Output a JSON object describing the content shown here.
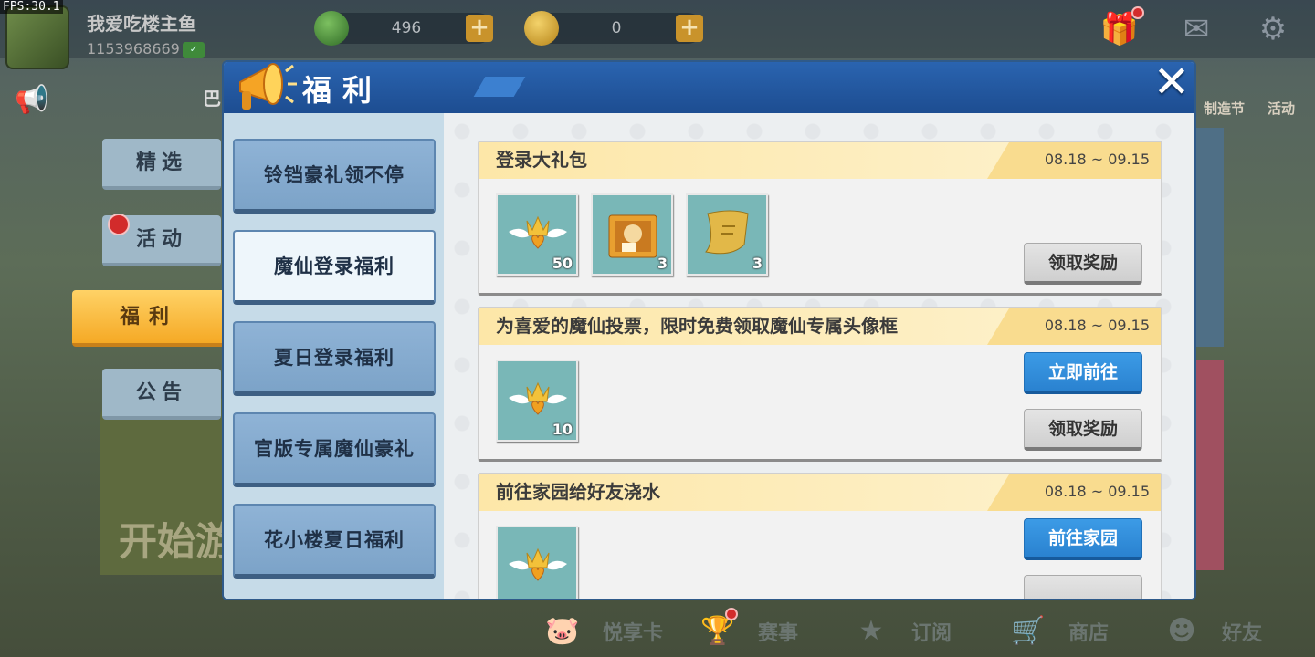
{
  "fps": "FPS:30.1",
  "user": {
    "name": "我爱吃楼主鱼",
    "id": "1153968669"
  },
  "currencies": [
    {
      "icon": "green-gem-icon",
      "amount": "496",
      "color": "#3f7d34"
    },
    {
      "icon": "gold-coin-icon",
      "amount": "0",
      "color": "#c99a25"
    }
  ],
  "top_side_labels": [
    "制造节",
    "活动"
  ],
  "sidebar_tabs": [
    {
      "label": "精选"
    },
    {
      "label": "活动",
      "badge": true
    },
    {
      "label": "福利",
      "active": true
    },
    {
      "label": "公告"
    }
  ],
  "background_text": {
    "partial_label": "巴",
    "start_label": "开始游"
  },
  "panel": {
    "title": "福利",
    "close_icon": "close-icon",
    "categories": [
      {
        "label": "铃铛豪礼领不停"
      },
      {
        "label": "魔仙登录福利",
        "active": true
      },
      {
        "label": "夏日登录福利"
      },
      {
        "label": "官版专属魔仙豪礼"
      },
      {
        "label": "花小楼夏日福利"
      }
    ],
    "cards": [
      {
        "title": "登录大礼包",
        "date": "08.18 ~ 09.15",
        "items": [
          {
            "icon": "winged-crown-heart-icon",
            "count": "50"
          },
          {
            "icon": "gift-bag-icon",
            "count": "3"
          },
          {
            "icon": "golden-scroll-icon",
            "count": "3"
          }
        ],
        "buttons": [
          {
            "label": "领取奖励",
            "style": "grey"
          }
        ]
      },
      {
        "title": "为喜爱的魔仙投票，限时免费领取魔仙专属头像框",
        "date": "08.18 ~ 09.15",
        "items": [
          {
            "icon": "winged-crown-heart-icon",
            "count": "10"
          }
        ],
        "buttons": [
          {
            "label": "立即前往",
            "style": "blue"
          },
          {
            "label": "领取奖励",
            "style": "grey"
          }
        ]
      },
      {
        "title": "前往家园给好友浇水",
        "date": "08.18 ~ 09.15",
        "items": [
          {
            "icon": "winged-crown-heart-icon",
            "count": ""
          }
        ],
        "buttons": [
          {
            "label": "前往家园",
            "style": "blue"
          }
        ]
      }
    ]
  },
  "bottom_nav": [
    {
      "label": "悦享卡",
      "icon": "pig-icon"
    },
    {
      "label": "赛事",
      "icon": "trophy-icon",
      "badge": true
    },
    {
      "label": "订阅",
      "icon": "star-icon"
    },
    {
      "label": "商店",
      "icon": "cart-icon"
    },
    {
      "label": "好友",
      "icon": "friend-icon"
    }
  ],
  "colors": {
    "header_blue": "#1d4d91",
    "active_tab": "#f5a925",
    "button_blue": "#2a82d0",
    "card_header": "#fde7a8"
  }
}
